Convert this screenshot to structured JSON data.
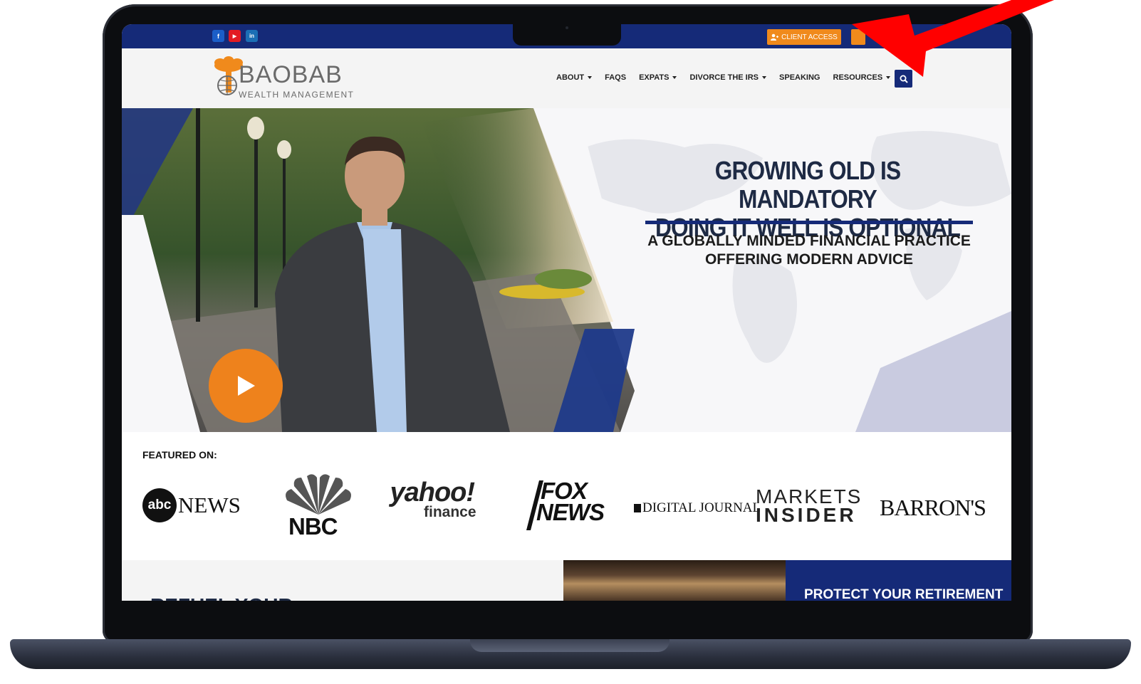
{
  "topbar": {
    "social": [
      {
        "icon": "facebook-icon",
        "glyph": "f",
        "color": "#1b5ec8"
      },
      {
        "icon": "youtube-icon",
        "glyph": "▶",
        "color": "#e31b23"
      },
      {
        "icon": "linkedin-icon",
        "glyph": "in",
        "color": "#1b6fb5"
      }
    ],
    "client_access_label": "CLIENT ACCESS"
  },
  "logo": {
    "word": "BAOBAB",
    "sub": "WEALTH MANAGEMENT"
  },
  "nav": {
    "items": [
      {
        "label": "ABOUT",
        "dropdown": true
      },
      {
        "label": "FAQS",
        "dropdown": false
      },
      {
        "label": "EXPATS",
        "dropdown": true
      },
      {
        "label": "DIVORCE THE IRS",
        "dropdown": true
      },
      {
        "label": "SPEAKING",
        "dropdown": false
      },
      {
        "label": "RESOURCES",
        "dropdown": true
      }
    ]
  },
  "hero": {
    "headline_line1": "GROWING OLD IS MANDATORY",
    "headline_line2": "DOING IT WELL IS OPTIONAL",
    "sub_line1": "A GLOBALLY MINDED FINANCIAL PRACTICE",
    "sub_line2": "OFFERING MODERN ADVICE"
  },
  "featured": {
    "label": "FEATURED ON:",
    "abc_badge": "abc",
    "abc_news": "NEWS",
    "nbc": "NBC",
    "yahoo_top": "yahoo!",
    "yahoo_bottom": "finance",
    "fox_top": "FOX",
    "fox_bottom": "NEWS",
    "digital_journal": "DIGITAL JOURNAL",
    "markets_top": "MARKETS",
    "markets_bottom": "INSIDER",
    "barrons": "BARRON'S"
  },
  "bottom": {
    "protect": "PROTECT YOUR RETIREMENT",
    "refuel": "REFUEL YOUR"
  },
  "colors": {
    "navy": "#152a78",
    "orange": "#f08a1c",
    "arrow": "#ff0000"
  }
}
